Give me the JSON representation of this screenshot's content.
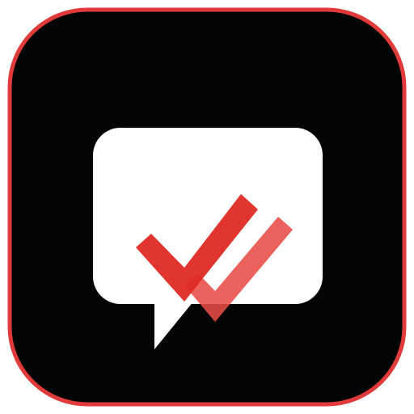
{
  "icon": {
    "name": "double-check-message-app-icon",
    "colors": {
      "background": "#ffffff",
      "tile_fill": "#030404",
      "tile_border": "#e03a3a",
      "bubble_fill": "#ffffff",
      "check_front": "#df2a24",
      "check_back": "#e84b45"
    },
    "parts": [
      "rounded-square-tile-icon",
      "chat-bubble-icon",
      "double-checkmark-icon"
    ]
  }
}
